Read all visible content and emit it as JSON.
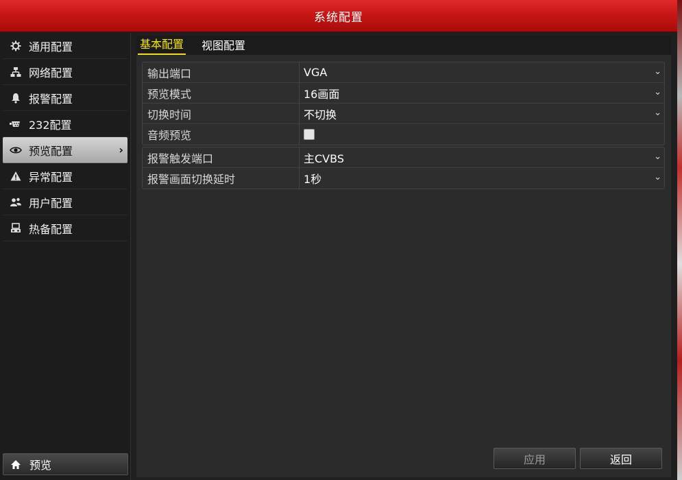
{
  "window": {
    "title": "系统配置"
  },
  "sidebar": {
    "items": [
      {
        "label": "通用配置",
        "icon": "gear-icon",
        "active": false
      },
      {
        "label": "网络配置",
        "icon": "network-icon",
        "active": false
      },
      {
        "label": "报警配置",
        "icon": "alarm-bell-icon",
        "active": false
      },
      {
        "label": "232配置",
        "icon": "serial-port-icon",
        "active": false
      },
      {
        "label": "预览配置",
        "icon": "eye-icon",
        "active": true
      },
      {
        "label": "异常配置",
        "icon": "warning-icon",
        "active": false
      },
      {
        "label": "用户配置",
        "icon": "users-icon",
        "active": false
      },
      {
        "label": "热备配置",
        "icon": "hot-backup-icon",
        "active": false
      }
    ],
    "preview_button": {
      "label": "预览",
      "icon": "home-icon"
    }
  },
  "tabs": [
    {
      "label": "基本配置",
      "active": true
    },
    {
      "label": "视图配置",
      "active": false
    }
  ],
  "groups": [
    {
      "rows": [
        {
          "label": "输出端口",
          "value": "VGA",
          "type": "select"
        },
        {
          "label": "预览模式",
          "value": "16画面",
          "type": "select"
        },
        {
          "label": "切换时间",
          "value": "不切换",
          "type": "select"
        },
        {
          "label": "音频预览",
          "value": "",
          "type": "checkbox",
          "checked": false
        }
      ]
    },
    {
      "rows": [
        {
          "label": "报警触发端口",
          "value": "主CVBS",
          "type": "select"
        },
        {
          "label": "报警画面切换延时",
          "value": "1秒",
          "type": "select"
        }
      ]
    }
  ],
  "buttons": {
    "apply": "应用",
    "back": "返回"
  },
  "colors": {
    "title_bar": "#c81616",
    "active_tab": "#f5e400",
    "active_nav": "#bdbdbd"
  }
}
